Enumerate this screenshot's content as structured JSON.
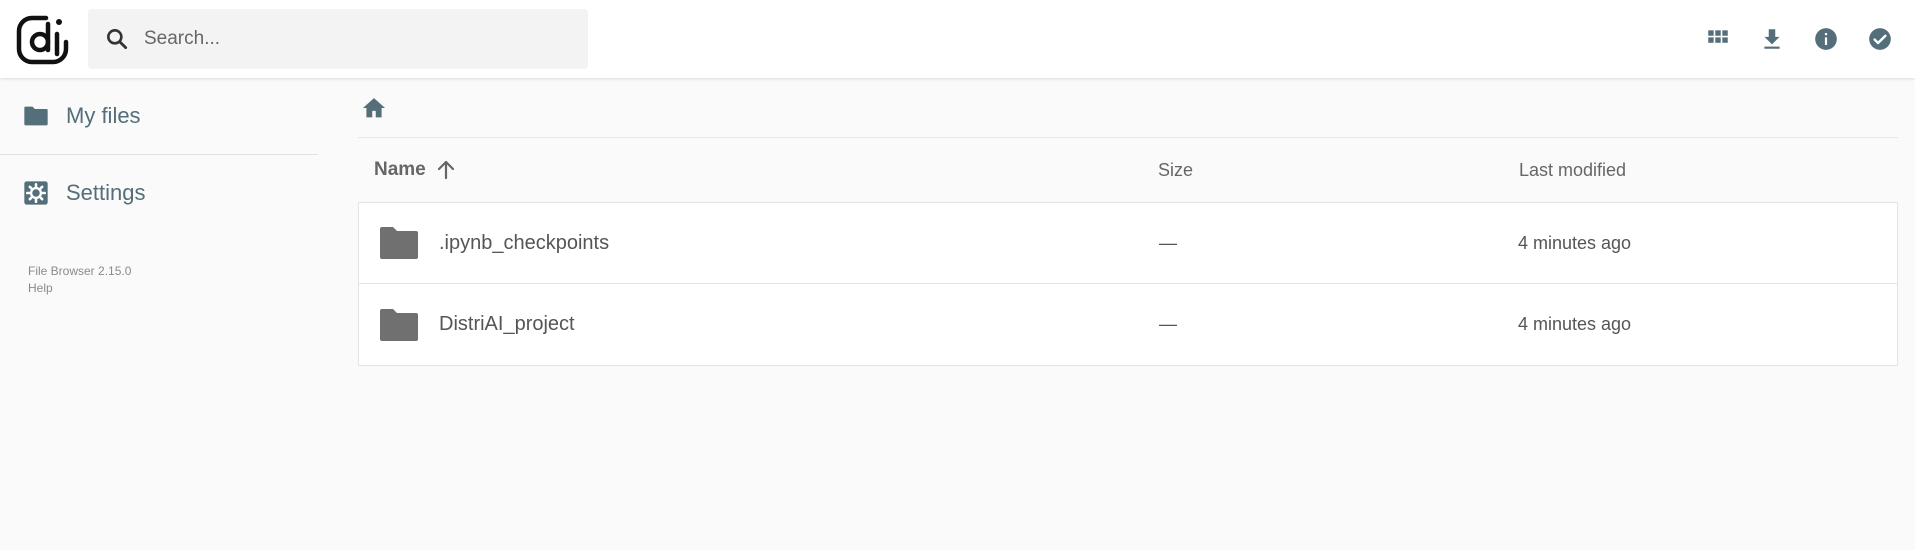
{
  "header": {
    "search_placeholder": "Search...",
    "actions": [
      "grid-view",
      "download",
      "info",
      "select"
    ]
  },
  "sidebar": {
    "items": [
      {
        "label": "My files",
        "icon": "folder-icon"
      },
      {
        "label": "Settings",
        "icon": "settings-icon"
      }
    ],
    "footer": {
      "version": "File Browser 2.15.0",
      "help": "Help"
    }
  },
  "list": {
    "columns": {
      "name": "Name",
      "size": "Size",
      "modified": "Last modified"
    },
    "sort": "name-ascending",
    "rows": [
      {
        "name": ".ipynb_checkpoints",
        "size": "—",
        "modified": "4 minutes ago"
      },
      {
        "name": "DistriAI_project",
        "size": "—",
        "modified": "4 minutes ago"
      }
    ]
  },
  "colors": {
    "accent": "#546e7a",
    "folder": "#707070",
    "background": "#fafafa"
  }
}
